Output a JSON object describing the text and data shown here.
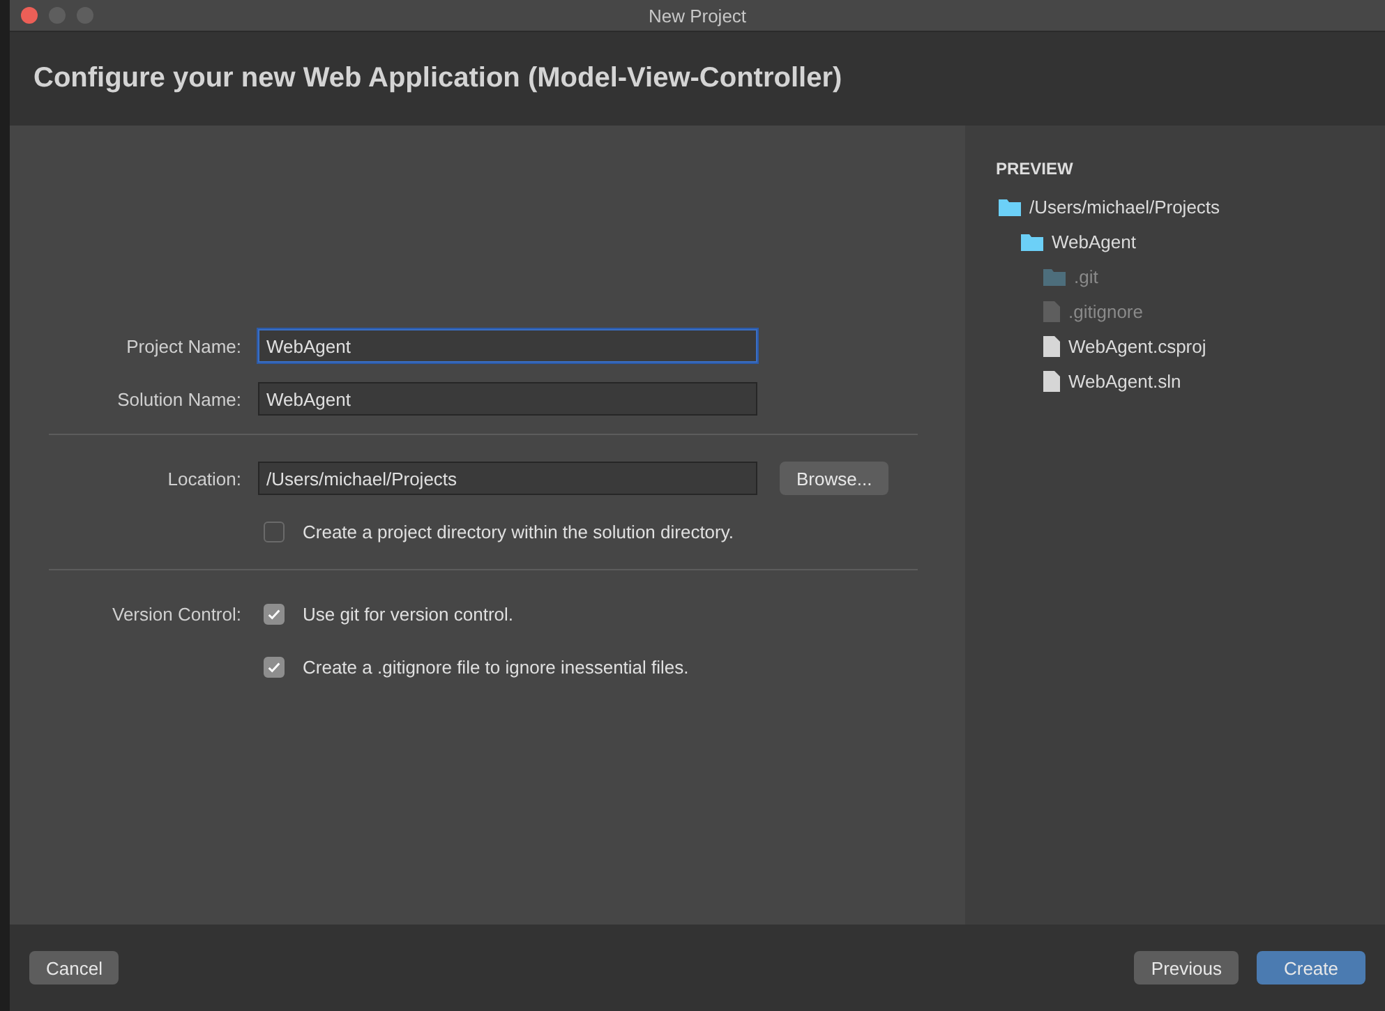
{
  "window": {
    "title": "New Project"
  },
  "header": {
    "title": "Configure your new Web Application (Model-View-Controller)"
  },
  "form": {
    "project_name": {
      "label": "Project Name:",
      "value": "WebAgent",
      "focused": true
    },
    "solution_name": {
      "label": "Solution Name:",
      "value": "WebAgent",
      "focused": false
    },
    "location": {
      "label": "Location:",
      "value": "/Users/michael/Projects",
      "focused": false,
      "button": "Browse..."
    },
    "create_directory": {
      "label": "Create a project directory within the solution directory.",
      "checked": false
    },
    "version_control": {
      "label": "Version Control:",
      "options": [
        {
          "label": "Use git for version control.",
          "checked": true
        },
        {
          "label": "Create a .gitignore file to ignore inessential files.",
          "checked": true
        }
      ]
    }
  },
  "preview": {
    "title": "PREVIEW",
    "tree": [
      {
        "label": "/Users/michael/Projects",
        "kind": "folder",
        "dimmed": false,
        "children": [
          {
            "label": "WebAgent",
            "kind": "folder",
            "dimmed": false,
            "children": [
              {
                "label": ".git",
                "kind": "folder",
                "dimmed": true
              },
              {
                "label": ".gitignore",
                "kind": "file",
                "dimmed": true
              },
              {
                "label": "WebAgent.csproj",
                "kind": "file",
                "dimmed": false
              },
              {
                "label": "WebAgent.sln",
                "kind": "file",
                "dimmed": false
              }
            ]
          }
        ]
      }
    ]
  },
  "footer": {
    "cancel": "Cancel",
    "previous": "Previous",
    "create": "Create"
  }
}
